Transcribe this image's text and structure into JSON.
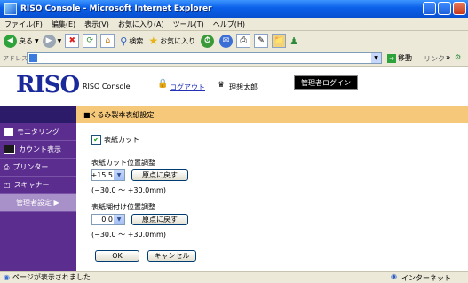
{
  "window": {
    "title": "RISO Console - Microsoft Internet Explorer"
  },
  "menu": [
    "ファイル(F)",
    "編集(E)",
    "表示(V)",
    "お気に入り(A)",
    "ツール(T)",
    "ヘルプ(H)"
  ],
  "toolbar": {
    "back_label": "戻る",
    "search_label": "検索",
    "favorites_label": "お気に入り"
  },
  "address": {
    "label": "アドレス(D)",
    "go_label": "移動",
    "links_label": "リンク"
  },
  "header": {
    "logo": "RISO",
    "console_label": "RISO Console",
    "logout_label": "ログアウト",
    "user_name": "理想太郎",
    "admin_login_label": "管理者ログイン"
  },
  "sidebar": {
    "items": [
      {
        "label": "モニタリング"
      },
      {
        "label": "カウント表示"
      },
      {
        "label": "プリンター"
      },
      {
        "label": "スキャナー"
      },
      {
        "label": "管理者設定 ▶"
      }
    ]
  },
  "main": {
    "section_title": "■くるみ製本表紙設定",
    "cover_cut_label": "表紙カット",
    "cover_cut_checked": true,
    "cut_position_label": "表紙カット位置調整",
    "cut_position_value": "+15.5",
    "cut_reset_label": "原点に戻す",
    "cut_range": "(−30.0 〜 +30.0mm)",
    "glue_position_label": "表紙糊付け位置調整",
    "glue_position_value": "0.0",
    "glue_reset_label": "原点に戻す",
    "glue_range": "(−30.0 〜 +30.0mm)",
    "ok_label": "OK",
    "cancel_label": "キャンセル"
  },
  "status": {
    "text": "ページが表示されました",
    "zone": "インターネット"
  },
  "colors": {
    "nav_bar": "#2b1b68",
    "sidebar": "#5b2d8f",
    "section_title_bg": "#f6c87a",
    "logo": "#1a2a9a"
  }
}
